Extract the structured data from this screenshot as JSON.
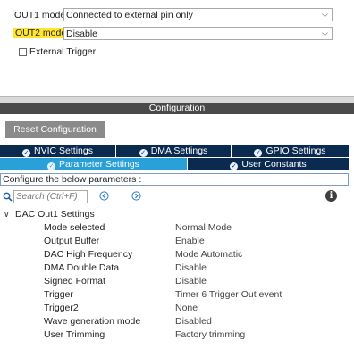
{
  "mode_settings": {
    "out1_label": "OUT1 mode",
    "out1_value": "Connected to external pin only",
    "out2_label": "OUT2 mode",
    "out2_value": "Disable",
    "external_trigger_label": "External Trigger",
    "external_trigger_checked": false
  },
  "configuration": {
    "title": "Configuration",
    "reset_label": "Reset Configuration",
    "tabs_row1": [
      {
        "label": "NVIC Settings",
        "icon": "check-circle-icon"
      },
      {
        "label": "DMA Settings",
        "icon": "check-circle-icon"
      },
      {
        "label": "GPIO Settings",
        "icon": "check-circle-icon"
      }
    ],
    "tabs_row2": [
      {
        "label": "Parameter Settings",
        "icon": "check-circle-icon",
        "active": true
      },
      {
        "label": "User Constants",
        "icon": "check-circle-icon",
        "active": false
      }
    ],
    "parameters_caption": "Configure the below parameters :",
    "search_placeholder": "Search (Ctrl+F)",
    "group_title": "DAC Out1 Settings",
    "params": [
      {
        "name": "Mode selected",
        "value": "Normal Mode"
      },
      {
        "name": "Output Buffer",
        "value": "Enable"
      },
      {
        "name": "DAC High Frequency",
        "value": "Mode Automatic"
      },
      {
        "name": "DMA Double Data",
        "value": "Disable"
      },
      {
        "name": "Signed Format",
        "value": "Disable"
      },
      {
        "name": "Trigger",
        "value": "Timer 6 Trigger Out event"
      },
      {
        "name": "Trigger2",
        "value": "None"
      },
      {
        "name": "Wave generation mode",
        "value": "Disabled"
      },
      {
        "name": "User Trimming",
        "value": "Factory trimming"
      }
    ]
  },
  "colors": {
    "tab_dark": "#0b2a50",
    "tab_active": "#2aa0d8",
    "highlight": "#ffe62e",
    "header_bar": "#4a4a4a"
  }
}
